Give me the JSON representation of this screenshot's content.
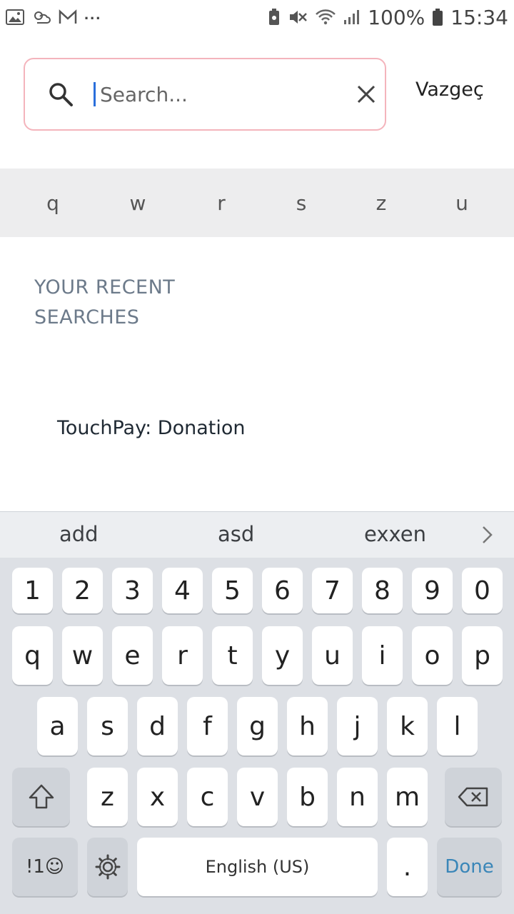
{
  "status_bar": {
    "left_icons": [
      "gallery-icon",
      "weather-icon",
      "mail-icon"
    ],
    "more": "...",
    "battery": "100%",
    "time": "15:34"
  },
  "search": {
    "placeholder": "Search...",
    "cancel_label": "Vazgeç"
  },
  "letter_filter": [
    "q",
    "w",
    "r",
    "s",
    "z",
    "u"
  ],
  "recent": {
    "heading": "YOUR RECENT SEARCHES",
    "items": [
      "TouchPay: Donation"
    ]
  },
  "keyboard": {
    "suggestions": [
      "add",
      "asd",
      "exxen"
    ],
    "number_row": [
      "1",
      "2",
      "3",
      "4",
      "5",
      "6",
      "7",
      "8",
      "9",
      "0"
    ],
    "row1": [
      "q",
      "w",
      "e",
      "r",
      "t",
      "y",
      "u",
      "i",
      "o",
      "p"
    ],
    "row2": [
      "a",
      "s",
      "d",
      "f",
      "g",
      "h",
      "j",
      "k",
      "l"
    ],
    "row3": [
      "z",
      "x",
      "c",
      "v",
      "b",
      "n",
      "m"
    ],
    "symbols_label": "!1☺",
    "space_label": "English (US)",
    "period_label": ".",
    "done_label": "Done"
  },
  "colors": {
    "search_border": "#f4b4bc",
    "done_accent": "#3a86b8",
    "heading_gray": "#6c7a8a"
  }
}
